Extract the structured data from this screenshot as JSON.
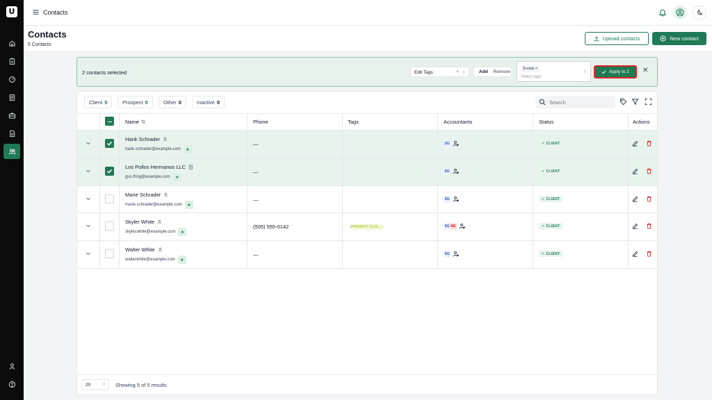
{
  "app": {
    "logo_text": "U"
  },
  "topbar": {
    "title": "Contacts"
  },
  "header": {
    "title": "Contacts",
    "subtitle": "5 Contacts",
    "upload_label": "Upload contacts",
    "new_label": "New contact"
  },
  "bulk": {
    "selected_text": "2 contacts selected",
    "edit_tags_value": "Edit Tags",
    "add_label": "Add",
    "remove_label": "Remove",
    "chip": "S-corp",
    "tags_placeholder": "Select tags",
    "apply_label": "Apply to 2"
  },
  "filters": [
    {
      "label": "Client",
      "count": "5"
    },
    {
      "label": "Prospect",
      "count": "0"
    },
    {
      "label": "Other",
      "count": "0"
    },
    {
      "label": "Inactive",
      "count": "0"
    }
  ],
  "search": {
    "placeholder": "Search"
  },
  "columns": {
    "name": "Name",
    "phone": "Phone",
    "tags": "Tags",
    "accountants": "Accountants",
    "status": "Status",
    "actions": "Actions"
  },
  "rows": [
    {
      "name": "Hank Schrader",
      "email": "hank.schrader@example.com",
      "phone": "—",
      "tag": "",
      "acct": [
        "SG"
      ],
      "status": "CLIENT",
      "selected": true,
      "type": "person"
    },
    {
      "name": "Los Pollos Hermanos LLC",
      "email": "gus.fring@example.com",
      "phone": "—",
      "tag": "",
      "acct": [
        "SG"
      ],
      "status": "CLIENT",
      "selected": true,
      "type": "company"
    },
    {
      "name": "Marie Schrader",
      "email": "marie.schrader@example.com",
      "phone": "—",
      "tag": "",
      "acct": [
        "SG"
      ],
      "status": "CLIENT",
      "selected": false,
      "type": "person"
    },
    {
      "name": "Skyler White",
      "email": "skylecwhite@example.com",
      "phone": "(505) 555-0142",
      "tag": "PRIORITY CLIE...",
      "acct": [
        "SG",
        "ME"
      ],
      "status": "CLIENT",
      "selected": false,
      "type": "person"
    },
    {
      "name": "Walter White",
      "email": "walterwhite@example.com",
      "phone": "—",
      "tag": "",
      "acct": [
        "SG"
      ],
      "status": "CLIENT",
      "selected": false,
      "type": "person"
    }
  ],
  "footer": {
    "page_size": "20",
    "showing": "Showing 5 of 5 results"
  },
  "colors": {
    "accent": "#1f7a55",
    "danger": "#dc2626",
    "sidebar": "#0b0b0b"
  }
}
